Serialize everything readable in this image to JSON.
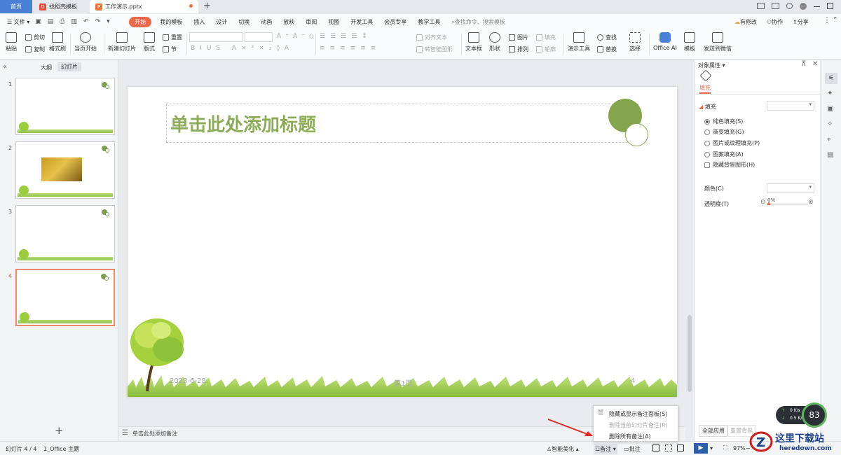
{
  "tabs": {
    "home": "首页",
    "template": "找稻壳模板",
    "doc": "工作演示.pptx",
    "new_tab": "+"
  },
  "menubar": {
    "file": "文件",
    "items": [
      "开始",
      "我的模板",
      "插入",
      "设计",
      "切换",
      "动画",
      "放映",
      "审阅",
      "视图",
      "开发工具",
      "会员专享",
      "教学工具"
    ],
    "search": "查找命令、搜索模板",
    "has_changes": "有修改",
    "collab": "协作",
    "share": "分享"
  },
  "ribbon": {
    "paste": "粘贴",
    "cut": "剪切",
    "copy": "复制",
    "format_painter": "格式刷",
    "play_current": "当页开始",
    "new_slide": "新建幻灯片",
    "layout": "版式",
    "reset": "重置",
    "section": "节",
    "align_text": "对齐文本",
    "smart_graphic": "转智能图形",
    "textbox": "文本框",
    "shape": "形状",
    "picture": "图片",
    "fill": "填充",
    "arrange": "排列",
    "outline": "轮廓",
    "presentation_tools": "演示工具",
    "find": "查找",
    "replace": "替换",
    "select": "选择",
    "office_ai": "Office AI",
    "template": "模板",
    "send_wechat": "发送到微信"
  },
  "leftpanel": {
    "outline_tab": "大纲",
    "slides_tab": "幻灯片",
    "slide_numbers": [
      "1",
      "2",
      "3",
      "4"
    ],
    "add": "+"
  },
  "slide": {
    "title": "单击此处添加标题",
    "date": "2023-6-28",
    "page": "第1页",
    "number": "4"
  },
  "notes": {
    "placeholder": "单击此处添加备注"
  },
  "popup": {
    "items": [
      "隐藏或显示备注面板(S)",
      "删除当前幻灯片备注(R)",
      "删除所有备注(A)"
    ]
  },
  "rightpanel": {
    "title": "对象属性",
    "tab_fill": "填充",
    "section_fill": "填充",
    "options": [
      "纯色填充(S)",
      "渐变填充(G)",
      "图片或纹理填充(P)",
      "图案填充(A)"
    ],
    "hide_bg": "隐藏背景图形(H)",
    "color_label": "颜色(C)",
    "transparency_label": "透明度(T)",
    "transparency_value": "0%",
    "apply_all": "全部应用",
    "reset_bg": "重置背景"
  },
  "statusbar": {
    "slide_info": "幻灯片 4 / 4",
    "theme": "1_Office 主题",
    "smart_beautify": "智能美化",
    "notes": "备注",
    "comment": "批注",
    "zoom": "97%"
  },
  "netspeed": {
    "up": "0 K/s",
    "down": "0.5 K/s",
    "percent": "83"
  },
  "watermark": {
    "text": "这里下载站",
    "url": "heredown.com"
  },
  "colors": {
    "accent_orange": "#e8694a",
    "title_green": "#8dac58",
    "home_blue": "#4a7fd6"
  }
}
